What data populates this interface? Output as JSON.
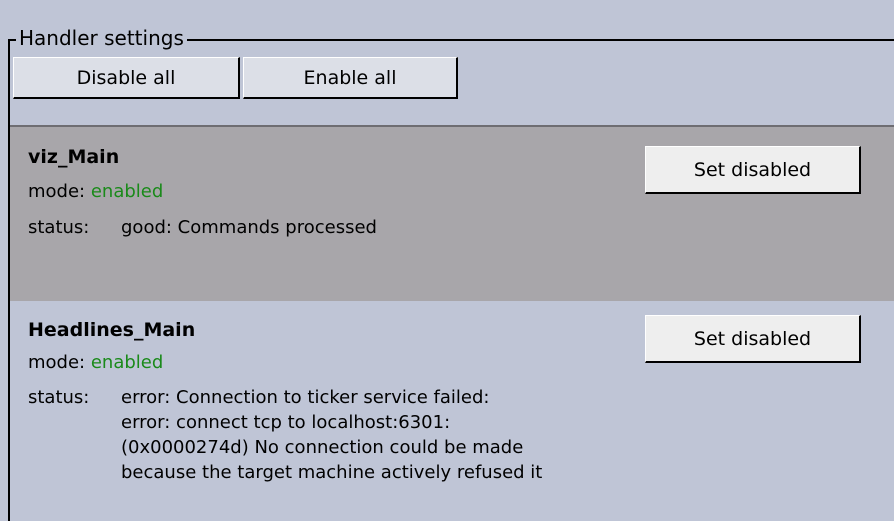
{
  "section": {
    "legend": "Handler settings",
    "disable_all_label": "Disable all",
    "enable_all_label": "Enable all"
  },
  "handlers": [
    {
      "name": "viz_Main",
      "mode_label": "mode:",
      "mode_value": "enabled",
      "status_label": "status:",
      "status_lines": [
        "good: Commands processed"
      ],
      "button_label": "Set disabled",
      "colors": {
        "background": "#a8a6aa",
        "mode": "#1a8a1a"
      }
    },
    {
      "name": "Headlines_Main",
      "mode_label": "mode:",
      "mode_value": "enabled",
      "status_label": "status:",
      "status_lines": [
        "error: Connection to ticker service failed:",
        "error: connect tcp to localhost:6301:",
        "(0x0000274d) No connection could be made",
        "because the target machine actively refused it"
      ],
      "button_label": "Set disabled",
      "colors": {
        "background": "#bfc5d6",
        "mode": "#1a8a1a"
      }
    }
  ]
}
